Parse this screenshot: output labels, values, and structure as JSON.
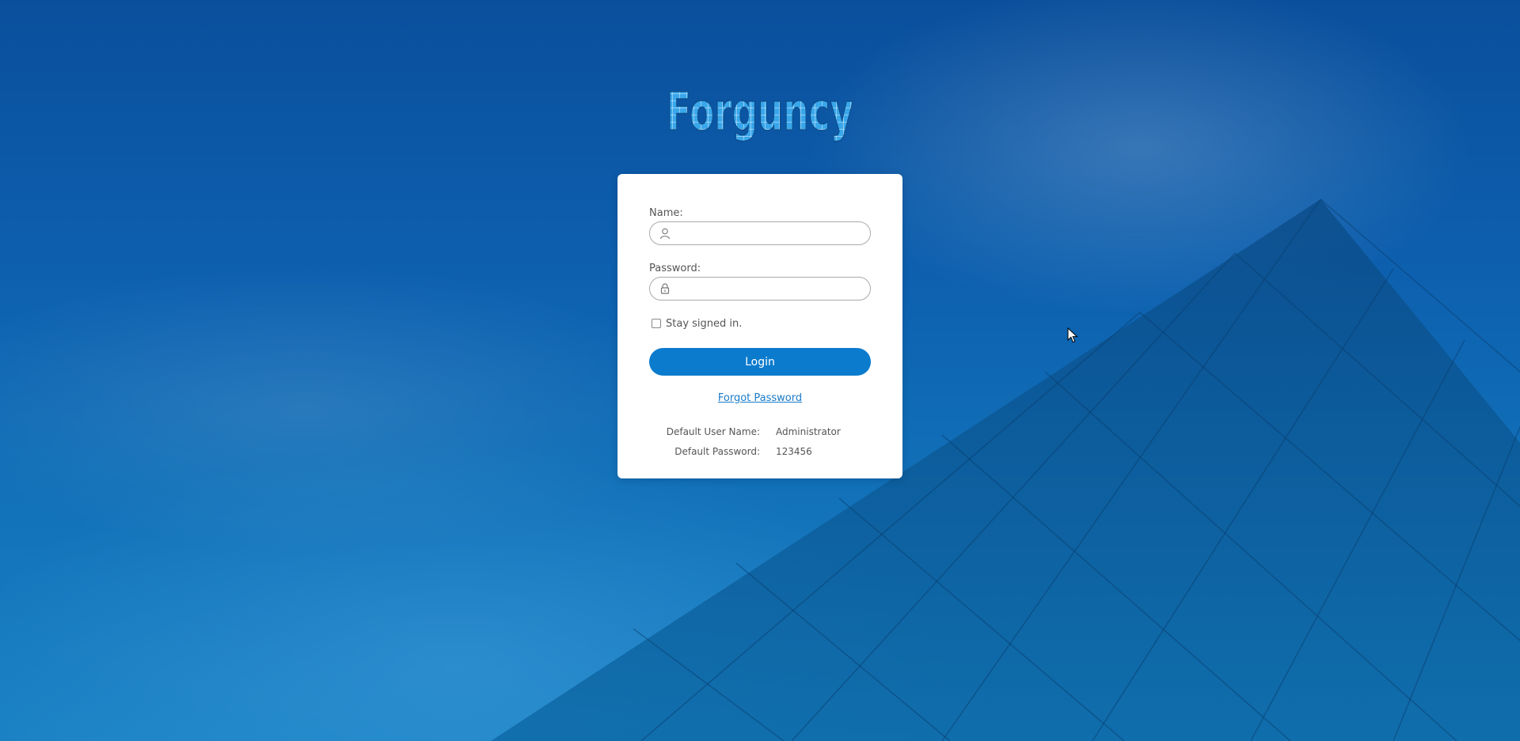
{
  "app": {
    "logo_text": "Forguncy"
  },
  "login": {
    "name_label": "Name:",
    "name_value": "",
    "password_label": "Password:",
    "password_value": "",
    "stay_signed_in_label": "Stay signed in.",
    "stay_signed_in_checked": false,
    "login_button": "Login",
    "forgot_password_link": "Forgot Password"
  },
  "defaults": [
    {
      "key": "Default User Name:",
      "value": "Administrator"
    },
    {
      "key": "Default Password:",
      "value": "123456"
    }
  ],
  "icons": {
    "name_field": "user-icon",
    "password_field": "lock-icon",
    "cursor": "mouse-pointer-icon"
  },
  "colors": {
    "accent": "#0b7bce",
    "link": "#1a7bc9",
    "background": "#0d5fae"
  }
}
